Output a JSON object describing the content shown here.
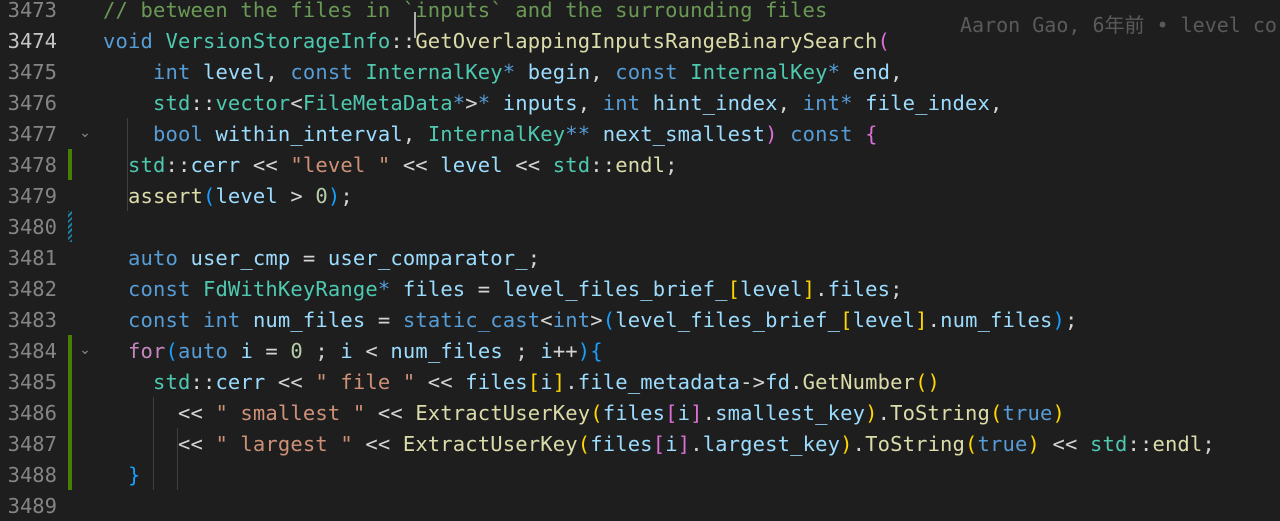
{
  "editor": {
    "blame_annotation": "Aaron Gao, 6年前 • level co",
    "lines": [
      {
        "number": "3473",
        "fold": "",
        "gutter": "",
        "tokens": [
          {
            "t": "// between the files in `inputs` and the surrounding files",
            "c": "cm"
          }
        ]
      },
      {
        "number": "3474",
        "current": true,
        "fold": "",
        "gutter": "",
        "tokens": [
          {
            "t": "void",
            "c": "kw"
          },
          {
            "t": " ",
            "c": "tx"
          },
          {
            "t": "VersionStorageInfo",
            "c": "ty"
          },
          {
            "t": "::",
            "c": "tx"
          },
          {
            "t": "GetOverlappingInputsRangeBinarySearch",
            "c": "fn"
          },
          {
            "t": "(",
            "c": "b2"
          }
        ]
      },
      {
        "number": "3475",
        "fold": "",
        "gutter": "",
        "tokens": [
          {
            "t": "    ",
            "c": "tx"
          },
          {
            "t": "int",
            "c": "kw"
          },
          {
            "t": " ",
            "c": "tx"
          },
          {
            "t": "level",
            "c": "var"
          },
          {
            "t": ", ",
            "c": "tx"
          },
          {
            "t": "const",
            "c": "kw"
          },
          {
            "t": " ",
            "c": "tx"
          },
          {
            "t": "InternalKey",
            "c": "ty"
          },
          {
            "t": "*",
            "c": "kw"
          },
          {
            "t": " ",
            "c": "tx"
          },
          {
            "t": "begin",
            "c": "var"
          },
          {
            "t": ", ",
            "c": "tx"
          },
          {
            "t": "const",
            "c": "kw"
          },
          {
            "t": " ",
            "c": "tx"
          },
          {
            "t": "InternalKey",
            "c": "ty"
          },
          {
            "t": "*",
            "c": "kw"
          },
          {
            "t": " ",
            "c": "tx"
          },
          {
            "t": "end",
            "c": "var"
          },
          {
            "t": ",",
            "c": "tx"
          }
        ]
      },
      {
        "number": "3476",
        "fold": "",
        "gutter": "",
        "tokens": [
          {
            "t": "    ",
            "c": "tx"
          },
          {
            "t": "std",
            "c": "ty"
          },
          {
            "t": "::",
            "c": "tx"
          },
          {
            "t": "vector",
            "c": "ty"
          },
          {
            "t": "<",
            "c": "tx"
          },
          {
            "t": "FileMetaData",
            "c": "ty"
          },
          {
            "t": "*",
            "c": "kw"
          },
          {
            "t": ">",
            "c": "tx"
          },
          {
            "t": "*",
            "c": "kw"
          },
          {
            "t": " ",
            "c": "tx"
          },
          {
            "t": "inputs",
            "c": "var"
          },
          {
            "t": ", ",
            "c": "tx"
          },
          {
            "t": "int",
            "c": "kw"
          },
          {
            "t": " ",
            "c": "tx"
          },
          {
            "t": "hint_index",
            "c": "var"
          },
          {
            "t": ", ",
            "c": "tx"
          },
          {
            "t": "int",
            "c": "kw"
          },
          {
            "t": "*",
            "c": "kw"
          },
          {
            "t": " ",
            "c": "tx"
          },
          {
            "t": "file_index",
            "c": "var"
          },
          {
            "t": ",",
            "c": "tx"
          }
        ]
      },
      {
        "number": "3477",
        "fold": "⌄",
        "gutter": "",
        "tokens": [
          {
            "t": "    ",
            "c": "tx"
          },
          {
            "t": "bool",
            "c": "kw"
          },
          {
            "t": " ",
            "c": "tx"
          },
          {
            "t": "within_interval",
            "c": "var"
          },
          {
            "t": ", ",
            "c": "tx"
          },
          {
            "t": "InternalKey",
            "c": "ty"
          },
          {
            "t": "**",
            "c": "kw"
          },
          {
            "t": " ",
            "c": "tx"
          },
          {
            "t": "next_smallest",
            "c": "var"
          },
          {
            "t": ")",
            "c": "b2"
          },
          {
            "t": " ",
            "c": "tx"
          },
          {
            "t": "const",
            "c": "kw"
          },
          {
            "t": " ",
            "c": "tx"
          },
          {
            "t": "{",
            "c": "b2"
          }
        ]
      },
      {
        "number": "3478",
        "fold": "",
        "gutter": "added",
        "tokens": [
          {
            "t": "  ",
            "c": "tx"
          },
          {
            "t": "std",
            "c": "ty"
          },
          {
            "t": "::",
            "c": "tx"
          },
          {
            "t": "cerr",
            "c": "var"
          },
          {
            "t": " << ",
            "c": "tx"
          },
          {
            "t": "\"level \"",
            "c": "str"
          },
          {
            "t": " << ",
            "c": "tx"
          },
          {
            "t": "level",
            "c": "var"
          },
          {
            "t": " << ",
            "c": "tx"
          },
          {
            "t": "std",
            "c": "ty"
          },
          {
            "t": "::",
            "c": "tx"
          },
          {
            "t": "endl",
            "c": "fn"
          },
          {
            "t": ";",
            "c": "tx"
          }
        ]
      },
      {
        "number": "3479",
        "fold": "",
        "gutter": "",
        "tokens": [
          {
            "t": "  ",
            "c": "tx"
          },
          {
            "t": "assert",
            "c": "fn"
          },
          {
            "t": "(",
            "c": "b3"
          },
          {
            "t": "level",
            "c": "var"
          },
          {
            "t": " > ",
            "c": "tx"
          },
          {
            "t": "0",
            "c": "num"
          },
          {
            "t": ")",
            "c": "b3"
          },
          {
            "t": ";",
            "c": "tx"
          }
        ]
      },
      {
        "number": "3480",
        "fold": "",
        "gutter": "modified",
        "tokens": []
      },
      {
        "number": "3481",
        "fold": "",
        "gutter": "",
        "tokens": [
          {
            "t": "  ",
            "c": "tx"
          },
          {
            "t": "auto",
            "c": "kw"
          },
          {
            "t": " ",
            "c": "tx"
          },
          {
            "t": "user_cmp",
            "c": "var"
          },
          {
            "t": " = ",
            "c": "tx"
          },
          {
            "t": "user_comparator_",
            "c": "var"
          },
          {
            "t": ";",
            "c": "tx"
          }
        ]
      },
      {
        "number": "3482",
        "fold": "",
        "gutter": "",
        "tokens": [
          {
            "t": "  ",
            "c": "tx"
          },
          {
            "t": "const",
            "c": "kw"
          },
          {
            "t": " ",
            "c": "tx"
          },
          {
            "t": "FdWithKeyRange",
            "c": "ty"
          },
          {
            "t": "*",
            "c": "kw"
          },
          {
            "t": " ",
            "c": "tx"
          },
          {
            "t": "files",
            "c": "var"
          },
          {
            "t": " = ",
            "c": "tx"
          },
          {
            "t": "level_files_brief_",
            "c": "var"
          },
          {
            "t": "[",
            "c": "b1"
          },
          {
            "t": "level",
            "c": "var"
          },
          {
            "t": "]",
            "c": "b1"
          },
          {
            "t": ".",
            "c": "tx"
          },
          {
            "t": "files",
            "c": "var"
          },
          {
            "t": ";",
            "c": "tx"
          }
        ]
      },
      {
        "number": "3483",
        "fold": "",
        "gutter": "",
        "tokens": [
          {
            "t": "  ",
            "c": "tx"
          },
          {
            "t": "const",
            "c": "kw"
          },
          {
            "t": " ",
            "c": "tx"
          },
          {
            "t": "int",
            "c": "kw"
          },
          {
            "t": " ",
            "c": "tx"
          },
          {
            "t": "num_files",
            "c": "var"
          },
          {
            "t": " = ",
            "c": "tx"
          },
          {
            "t": "static_cast",
            "c": "kw"
          },
          {
            "t": "<",
            "c": "tx"
          },
          {
            "t": "int",
            "c": "kw"
          },
          {
            "t": ">",
            "c": "tx"
          },
          {
            "t": "(",
            "c": "b3"
          },
          {
            "t": "level_files_brief_",
            "c": "var"
          },
          {
            "t": "[",
            "c": "b1"
          },
          {
            "t": "level",
            "c": "var"
          },
          {
            "t": "]",
            "c": "b1"
          },
          {
            "t": ".",
            "c": "tx"
          },
          {
            "t": "num_files",
            "c": "var"
          },
          {
            "t": ")",
            "c": "b3"
          },
          {
            "t": ";",
            "c": "tx"
          }
        ]
      },
      {
        "number": "3484",
        "fold": "⌄",
        "gutter": "added",
        "tokens": [
          {
            "t": "  ",
            "c": "tx"
          },
          {
            "t": "for",
            "c": "ctl"
          },
          {
            "t": "(",
            "c": "b3"
          },
          {
            "t": "auto",
            "c": "kw"
          },
          {
            "t": " ",
            "c": "tx"
          },
          {
            "t": "i",
            "c": "var"
          },
          {
            "t": " = ",
            "c": "tx"
          },
          {
            "t": "0",
            "c": "num"
          },
          {
            "t": " ; ",
            "c": "tx"
          },
          {
            "t": "i",
            "c": "var"
          },
          {
            "t": " < ",
            "c": "tx"
          },
          {
            "t": "num_files",
            "c": "var"
          },
          {
            "t": " ; ",
            "c": "tx"
          },
          {
            "t": "i",
            "c": "var"
          },
          {
            "t": "++",
            "c": "tx"
          },
          {
            "t": ")",
            "c": "b3"
          },
          {
            "t": "{",
            "c": "b3"
          }
        ]
      },
      {
        "number": "3485",
        "fold": "",
        "gutter": "added",
        "tokens": [
          {
            "t": "    ",
            "c": "tx"
          },
          {
            "t": "std",
            "c": "ty"
          },
          {
            "t": "::",
            "c": "tx"
          },
          {
            "t": "cerr",
            "c": "var"
          },
          {
            "t": " << ",
            "c": "tx"
          },
          {
            "t": "\" file \"",
            "c": "str"
          },
          {
            "t": " << ",
            "c": "tx"
          },
          {
            "t": "files",
            "c": "var"
          },
          {
            "t": "[",
            "c": "b1"
          },
          {
            "t": "i",
            "c": "var"
          },
          {
            "t": "]",
            "c": "b1"
          },
          {
            "t": ".",
            "c": "tx"
          },
          {
            "t": "file_metadata",
            "c": "var"
          },
          {
            "t": "->",
            "c": "tx"
          },
          {
            "t": "fd",
            "c": "var"
          },
          {
            "t": ".",
            "c": "tx"
          },
          {
            "t": "GetNumber",
            "c": "fn"
          },
          {
            "t": "()",
            "c": "b1"
          }
        ]
      },
      {
        "number": "3486",
        "fold": "",
        "gutter": "added",
        "tokens": [
          {
            "t": "      ",
            "c": "tx"
          },
          {
            "t": "<< ",
            "c": "tx"
          },
          {
            "t": "\" smallest \"",
            "c": "str"
          },
          {
            "t": " << ",
            "c": "tx"
          },
          {
            "t": "ExtractUserKey",
            "c": "fn"
          },
          {
            "t": "(",
            "c": "b1"
          },
          {
            "t": "files",
            "c": "var"
          },
          {
            "t": "[",
            "c": "b2"
          },
          {
            "t": "i",
            "c": "var"
          },
          {
            "t": "]",
            "c": "b2"
          },
          {
            "t": ".",
            "c": "tx"
          },
          {
            "t": "smallest_key",
            "c": "var"
          },
          {
            "t": ")",
            "c": "b1"
          },
          {
            "t": ".",
            "c": "tx"
          },
          {
            "t": "ToString",
            "c": "fn"
          },
          {
            "t": "(",
            "c": "b1"
          },
          {
            "t": "true",
            "c": "kw"
          },
          {
            "t": ")",
            "c": "b1"
          }
        ]
      },
      {
        "number": "3487",
        "fold": "",
        "gutter": "added",
        "tokens": [
          {
            "t": "      ",
            "c": "tx"
          },
          {
            "t": "<< ",
            "c": "tx"
          },
          {
            "t": "\" largest \"",
            "c": "str"
          },
          {
            "t": " << ",
            "c": "tx"
          },
          {
            "t": "ExtractUserKey",
            "c": "fn"
          },
          {
            "t": "(",
            "c": "b1"
          },
          {
            "t": "files",
            "c": "var"
          },
          {
            "t": "[",
            "c": "b2"
          },
          {
            "t": "i",
            "c": "var"
          },
          {
            "t": "]",
            "c": "b2"
          },
          {
            "t": ".",
            "c": "tx"
          },
          {
            "t": "largest_key",
            "c": "var"
          },
          {
            "t": ")",
            "c": "b1"
          },
          {
            "t": ".",
            "c": "tx"
          },
          {
            "t": "ToString",
            "c": "fn"
          },
          {
            "t": "(",
            "c": "b1"
          },
          {
            "t": "true",
            "c": "kw"
          },
          {
            "t": ")",
            "c": "b1"
          },
          {
            "t": " << ",
            "c": "tx"
          },
          {
            "t": "std",
            "c": "ty"
          },
          {
            "t": "::",
            "c": "tx"
          },
          {
            "t": "endl",
            "c": "fn"
          },
          {
            "t": ";",
            "c": "tx"
          }
        ]
      },
      {
        "number": "3488",
        "fold": "",
        "gutter": "added",
        "tokens": [
          {
            "t": "  ",
            "c": "tx"
          },
          {
            "t": "}",
            "c": "b3"
          }
        ]
      },
      {
        "number": "3489",
        "fold": "",
        "gutter": "",
        "tokens": []
      }
    ]
  }
}
